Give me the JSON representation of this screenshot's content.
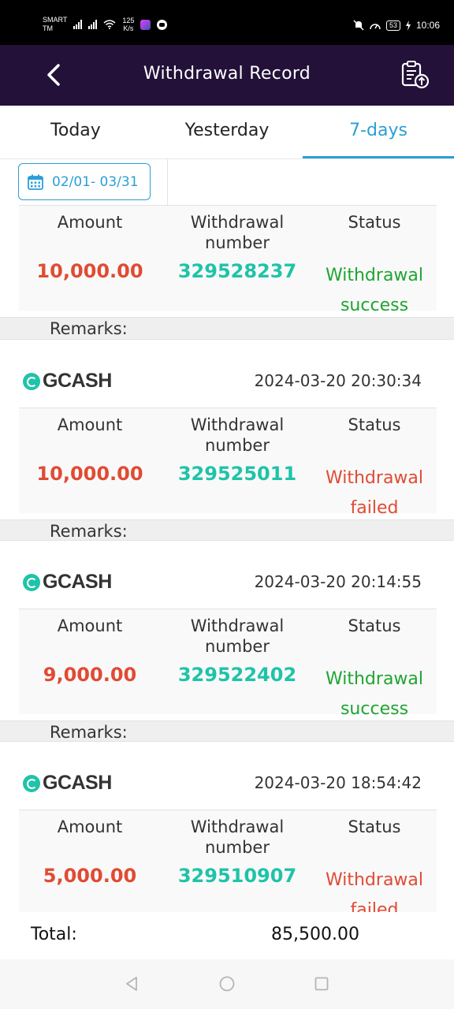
{
  "status_bar": {
    "carrier_line1": "SMART",
    "carrier_line2": "TM",
    "speed_value": "125",
    "speed_unit": "K/s",
    "battery": "53",
    "time": "10:06"
  },
  "header": {
    "title": "Withdrawal Record",
    "back_icon": "chevron-left-icon",
    "action_icon": "clipboard-export-icon"
  },
  "tabs": [
    {
      "label": "Today",
      "active": false
    },
    {
      "label": "Yesterday",
      "active": false
    },
    {
      "label": "7-days",
      "active": true
    }
  ],
  "filter": {
    "date_range": "02/01- 03/31",
    "icon": "calendar-icon"
  },
  "columns": {
    "amount": "Amount",
    "number_line1": "Withdrawal",
    "number_line2": "number",
    "status": "Status",
    "remarks": "Remarks:"
  },
  "records": [
    {
      "method": "",
      "datetime": "",
      "amount": "10,000.00",
      "number": "329528237",
      "status_line1": "Withdrawal",
      "status_line2": "success",
      "status_color": "#1fa531"
    },
    {
      "method": "GCASH",
      "datetime": "2024-03-20 20:30:34",
      "amount": "10,000.00",
      "number": "329525011",
      "status_line1": "Withdrawal",
      "status_line2": "failed",
      "status_color": "#e04b33"
    },
    {
      "method": "GCASH",
      "datetime": "2024-03-20 20:14:55",
      "amount": "9,000.00",
      "number": "329522402",
      "status_line1": "Withdrawal",
      "status_line2": "success",
      "status_color": "#1fa531"
    },
    {
      "method": "GCASH",
      "datetime": "2024-03-20 18:54:42",
      "amount": "5,000.00",
      "number": "329510907",
      "status_line1": "Withdrawal",
      "status_line2": "failed",
      "status_color": "#e04b33"
    }
  ],
  "total": {
    "label": "Total:",
    "value": "85,500.00"
  },
  "colors": {
    "header_bg": "#231139",
    "accent": "#2a9fd6",
    "amount": "#e04b33",
    "number": "#1fc3a8",
    "success": "#1fa531",
    "failed": "#e04b33"
  }
}
